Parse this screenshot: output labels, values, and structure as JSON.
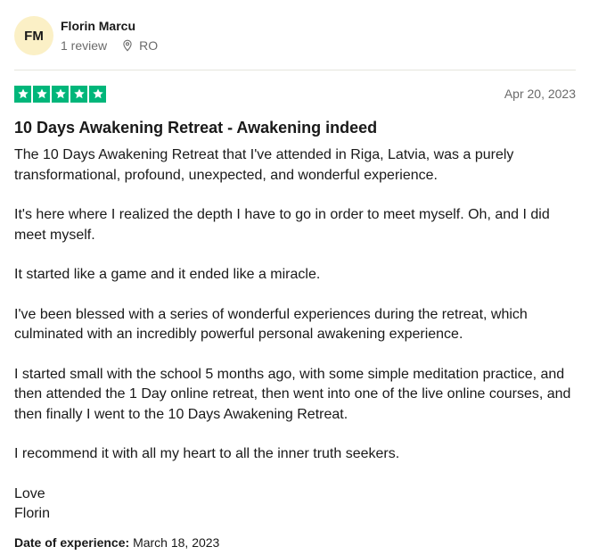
{
  "consumer": {
    "initials": "FM",
    "name": "Florin Marcu",
    "review_count": "1 review",
    "country": "RO",
    "location_icon": "map-pin-icon"
  },
  "review": {
    "rating": 5,
    "rating_max": 5,
    "star_color": "#00b67a",
    "date": "Apr 20, 2023",
    "title": "10 Days Awakening Retreat - Awakening indeed",
    "paragraphs": [
      "The 10 Days Awakening Retreat that I've attended in Riga, Latvia, was a purely transformational, profound, unexpected, and wonderful experience.",
      "It's here where I realized the depth I have to go in order to meet myself. Oh, and I did meet myself.",
      "It started like a game and it ended like a miracle.",
      "I've been blessed with a series of wonderful experiences during the retreat, which culminated with an incredibly powerful personal awakening experience.",
      "I started small with the school 5 months ago, with some simple meditation practice, and then attended the 1 Day online retreat, then went into one of the live online courses, and then finally I went to the 10 Days Awakening Retreat.",
      "I recommend it with all my heart to all the inner truth seekers."
    ],
    "signoff_line1": "Love",
    "signoff_line2": "Florin",
    "experience_label": "Date of experience:",
    "experience_date": "March 18, 2023"
  }
}
